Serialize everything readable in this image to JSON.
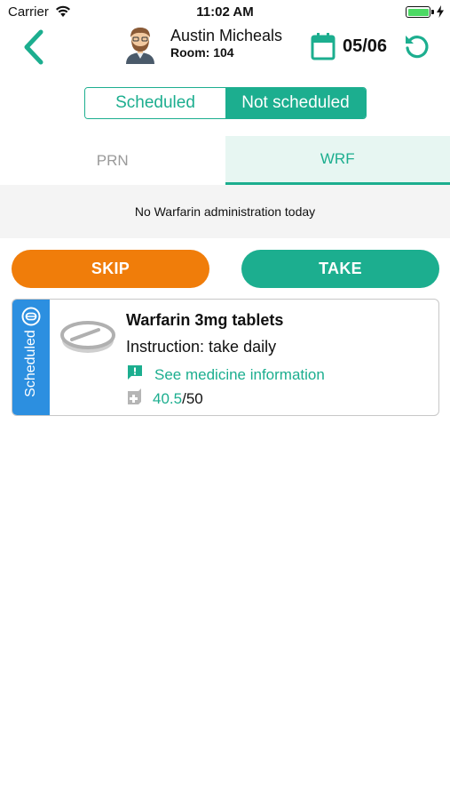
{
  "status_bar": {
    "carrier": "Carrier",
    "time": "11:02 AM",
    "battery_level": 1.0
  },
  "header": {
    "patient_name": "Austin Micheals",
    "room": "Room: 104",
    "date": "05/06"
  },
  "segmented": {
    "options": [
      "Scheduled",
      "Not scheduled"
    ],
    "selected": "Not scheduled"
  },
  "tabs": {
    "items": [
      "PRN",
      "WRF"
    ],
    "selected": "WRF"
  },
  "info_message": "No Warfarin administration today",
  "actions": {
    "skip_label": "SKIP",
    "take_label": "TAKE"
  },
  "medicine_card": {
    "status_label": "Scheduled",
    "name": "Warfarin 3mg tablets",
    "instruction": "Instruction: take daily",
    "info_link": "See medicine information",
    "stock_current": "40.5",
    "stock_total": "/50"
  },
  "colors": {
    "accent_green": "#1cae8f",
    "skip_orange": "#f07d0a",
    "scheduled_blue": "#2c8fe0",
    "tab_selected_bg": "#e7f6f2",
    "info_bar_bg": "#f4f4f4"
  },
  "icons": {
    "back": "chevron-left-icon",
    "avatar": "avatar-icon",
    "calendar": "calendar-icon",
    "refresh": "refresh-icon",
    "strip": "pill-badge-icon",
    "pill": "pill-icon",
    "info": "message-alert-icon",
    "stock": "medicine-box-icon"
  }
}
